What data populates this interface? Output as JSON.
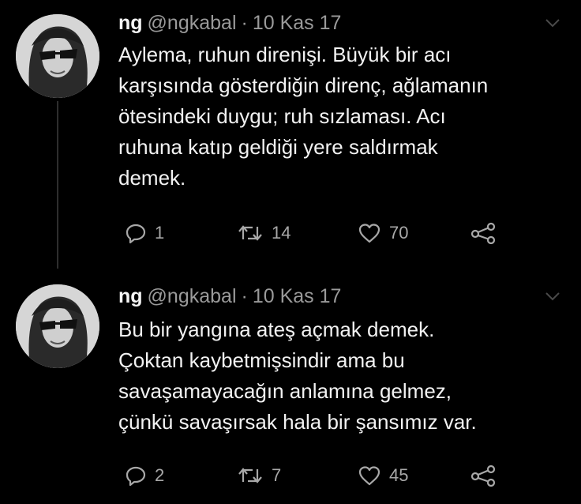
{
  "colors": {
    "background": "#000000",
    "text": "#f2f2f2",
    "muted": "#9a9a9a"
  },
  "tweets": [
    {
      "name": "ng",
      "handle": "@ngkabal",
      "separator": "·",
      "date": "10 Kas 17",
      "lines": [
        "Aylema, ruhun direnişi. Büyük bir acı",
        "karşısında gösterdiğin direnç, ağlamanın",
        "ötesindeki duygu; ruh sızlaması. Acı",
        "ruhuna katıp geldiği yere saldırmak",
        "demek."
      ],
      "replies": "1",
      "retweets": "14",
      "likes": "70",
      "icons": [
        "avatar",
        "chevron-down-icon",
        "reply-icon",
        "retweet-icon",
        "heart-icon",
        "share-icon"
      ]
    },
    {
      "name": "ng",
      "handle": "@ngkabal",
      "separator": "·",
      "date": "10 Kas 17",
      "lines": [
        "Bu bir yangına ateş açmak demek.",
        "Çoktan kaybetmişsindir ama bu",
        "savaşamayacağın anlamına gelmez,",
        "çünkü savaşırsak hala bir şansımız var."
      ],
      "replies": "2",
      "retweets": "7",
      "likes": "45",
      "icons": [
        "avatar",
        "chevron-down-icon",
        "reply-icon",
        "retweet-icon",
        "heart-icon",
        "share-icon"
      ]
    }
  ]
}
